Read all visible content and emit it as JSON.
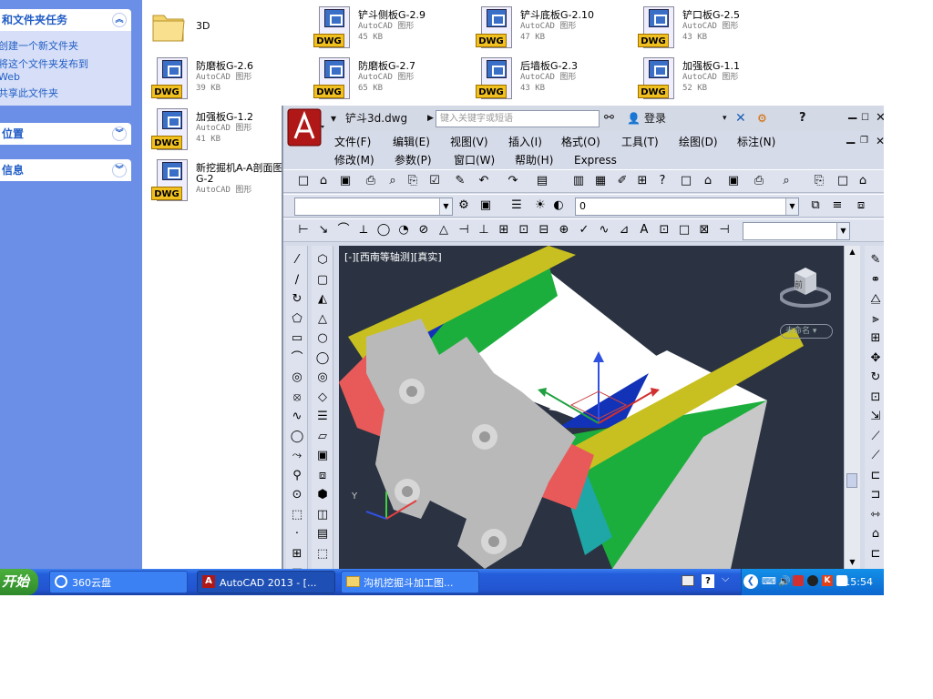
{
  "explorer": {
    "task_panels": [
      {
        "title": "和文件夹任务",
        "links": [
          "创建一个新文件夹",
          "将这个文件夹发布到\nWeb",
          "共享此文件夹"
        ]
      },
      {
        "title": "位置",
        "links": []
      },
      {
        "title": "信息",
        "links": []
      }
    ],
    "files": [
      {
        "name": "3D",
        "type": "",
        "size": "",
        "icon": "folder-icon"
      },
      {
        "name": "铲斗侧板G-2.9",
        "type": "AutoCAD 图形",
        "size": "45 KB",
        "icon": "dwg-file-icon"
      },
      {
        "name": "铲斗底板G-2.10",
        "type": "AutoCAD 图形",
        "size": "47 KB",
        "icon": "dwg-file-icon"
      },
      {
        "name": "铲口板G-2.5",
        "type": "AutoCAD 图形",
        "size": "43 KB",
        "icon": "dwg-file-icon"
      },
      {
        "name": "防磨板G-2.6",
        "type": "AutoCAD 图形",
        "size": "39 KB",
        "icon": "dwg-file-icon"
      },
      {
        "name": "防磨板G-2.7",
        "type": "AutoCAD 图形",
        "size": "65 KB",
        "icon": "dwg-file-icon"
      },
      {
        "name": "后墙板G-2.3",
        "type": "AutoCAD 图形",
        "size": "43 KB",
        "icon": "dwg-file-icon"
      },
      {
        "name": "加强板G-1.1",
        "type": "AutoCAD 图形",
        "size": "52 KB",
        "icon": "dwg-file-icon"
      },
      {
        "name": "加强板G-1.2",
        "type": "AutoCAD 图形",
        "size": "41 KB",
        "icon": "dwg-file-icon"
      },
      {
        "name": "新挖掘机A-A剖面图\nG-2",
        "type": "AutoCAD 图形",
        "size": "",
        "icon": "dwg-file-icon"
      }
    ],
    "dwg_tag": "DWG"
  },
  "autocad": {
    "filename": "铲斗3d.dwg",
    "search_placeholder": "键入关键字或短语",
    "login": "登录",
    "menu_row1": [
      "文件(F)",
      "编辑(E)",
      "视图(V)",
      "插入(I)",
      "格式(O)",
      "工具(T)",
      "绘图(D)",
      "标注(N)"
    ],
    "menu_row2": [
      "修改(M)",
      "参数(P)",
      "窗口(W)",
      "帮助(H)",
      "Express"
    ],
    "layer_value": "0",
    "viewport_label": "[-][西南等轴测][真实]",
    "viewcube_label": "未命名",
    "viewcube_face": "前"
  },
  "taskbar": {
    "start_label": "开始",
    "buttons": [
      "360云盘",
      "AutoCAD 2013 - [...",
      "沟机挖掘斗加工图..."
    ],
    "clock": "15:54"
  },
  "colors": {
    "xp_blue": "#245edb",
    "task_bg": "#6b8ee6",
    "viewport_bg": "#2b3342",
    "dwg_yellow": "#f0c020"
  }
}
